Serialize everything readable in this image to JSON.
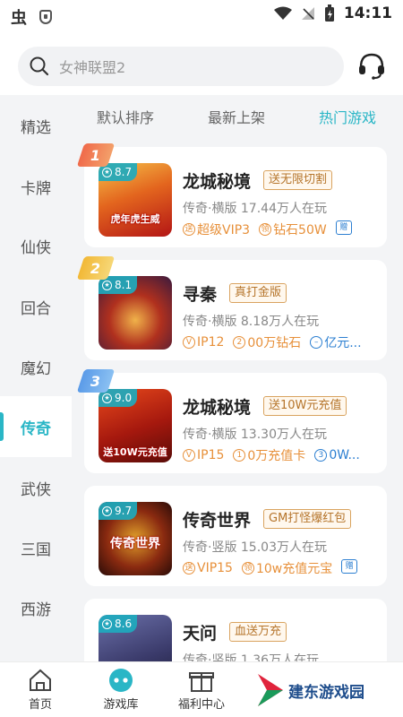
{
  "status_bar": {
    "time": "14:11",
    "app_icon": "虫"
  },
  "search": {
    "placeholder": "女神联盟2"
  },
  "sidebar": {
    "items": [
      {
        "label": "精选"
      },
      {
        "label": "卡牌"
      },
      {
        "label": "仙侠"
      },
      {
        "label": "回合"
      },
      {
        "label": "魔幻"
      },
      {
        "label": "传奇",
        "active": true
      },
      {
        "label": "武侠"
      },
      {
        "label": "三国"
      },
      {
        "label": "西游"
      }
    ]
  },
  "sort_tabs": [
    {
      "label": "默认排序"
    },
    {
      "label": "最新上架"
    },
    {
      "label": "热门游戏",
      "active": true
    }
  ],
  "games": [
    {
      "rank": "1",
      "score": "8.7",
      "name": "龙城秘境",
      "tag": "送无限切割",
      "meta": "传奇·横版  17.44万人在玩",
      "perk1": "超级VIP3",
      "perk2": "钻石50W",
      "perk3": "",
      "thumb_text": "虎年虎生威"
    },
    {
      "rank": "2",
      "score": "8.1",
      "name": "寻秦",
      "tag": "真打金版",
      "meta": "传奇·横版  8.18万人在玩",
      "perk1": "IP12",
      "perk2": "00万钻石",
      "perk3": "亿元...",
      "thumb_text": ""
    },
    {
      "rank": "3",
      "score": "9.0",
      "name": "龙城秘境",
      "tag": "送10W元充值",
      "meta": "传奇·横版  13.30万人在玩",
      "perk1": "IP15",
      "perk2": "0万充值卡",
      "perk3": "0W...",
      "thumb_text": "送10W元充值"
    },
    {
      "rank": "",
      "score": "9.7",
      "name": "传奇世界",
      "tag": "GM打怪爆红包",
      "meta": "传奇·竖版  15.03万人在玩",
      "perk1": "VIP15",
      "perk2": "10w充值元宝",
      "perk3": "",
      "thumb_text": "传奇世界"
    },
    {
      "rank": "",
      "score": "8.6",
      "name": "天问",
      "tag": "血送万充",
      "meta": "传奇·竖版  1.36万人在玩",
      "perk1": "",
      "perk2": "",
      "perk3": "",
      "thumb_text": ""
    }
  ],
  "bottom_nav": [
    {
      "label": "首页"
    },
    {
      "label": "游戏库",
      "active": true
    },
    {
      "label": "福利中心"
    }
  ],
  "watermark": {
    "text": "建东游戏园"
  },
  "colors": {
    "accent": "#2ab6c6",
    "tag": "#b5742a",
    "perk": "#e7903a",
    "link": "#2c7fd1"
  }
}
